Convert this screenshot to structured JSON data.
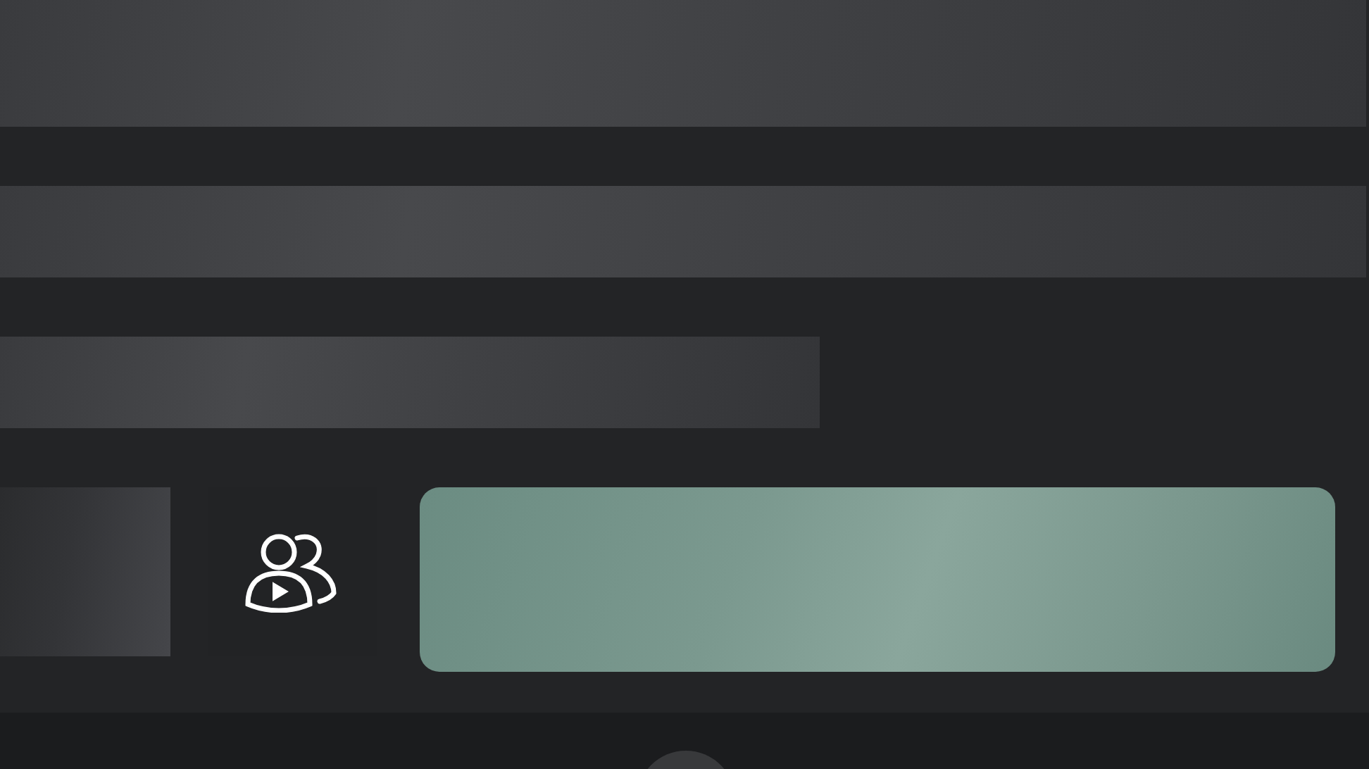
{
  "placeholders": [
    {
      "kind": "banner"
    },
    {
      "kind": "line"
    },
    {
      "kind": "stub"
    }
  ],
  "actions": [
    {
      "kind": "thumbnail"
    },
    {
      "kind": "icon"
    },
    {
      "kind": "action"
    }
  ],
  "bottom_bar": {
    "kind": "nav"
  }
}
